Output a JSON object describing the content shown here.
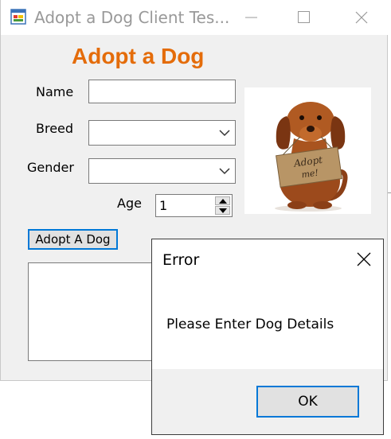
{
  "window": {
    "title": "Adopt a Dog Client Tes...",
    "app_icon": "winforms-app-icon",
    "controls": [
      "minimize-icon",
      "maximize-icon",
      "close-icon"
    ]
  },
  "form": {
    "heading": "Adopt a Dog",
    "heading_color": "#e46c0a",
    "name_label": "Name",
    "name_value": "",
    "breed_label": "Breed",
    "breed_value": "",
    "gender_label": "Gender",
    "gender_value": "",
    "age_label": "Age",
    "age_value": "1",
    "adopt_button": "Adopt A Dog",
    "output_list": "",
    "photo_sign_text": "Adopt me!"
  },
  "dialog": {
    "title": "Error",
    "message": "Please Enter Dog Details",
    "ok_button": "OK",
    "accent": "#0078d7"
  }
}
